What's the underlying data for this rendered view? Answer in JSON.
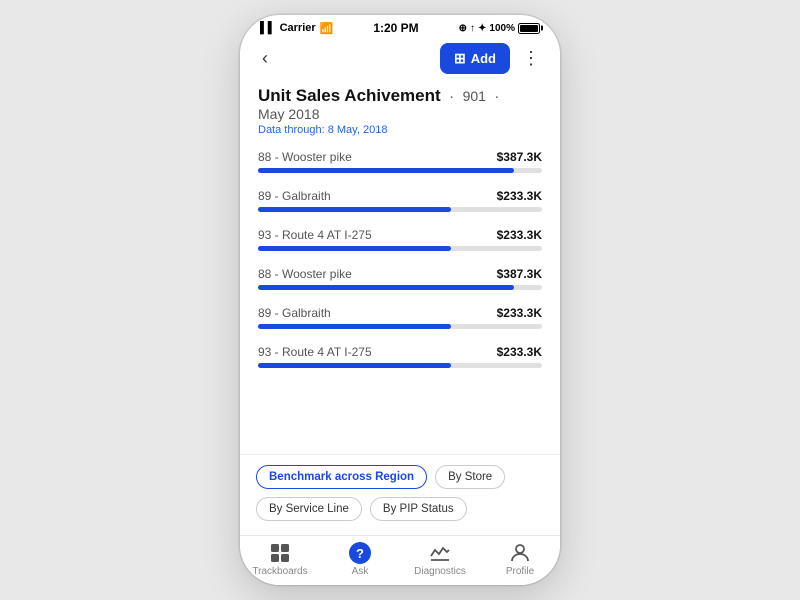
{
  "statusBar": {
    "carrier": "Carrier",
    "time": "1:20 PM",
    "battery": "100%"
  },
  "toolbar": {
    "addLabel": "Add",
    "moreLabel": "⋮"
  },
  "header": {
    "titleMain": "Unit Sales Achivement",
    "dot1": "·",
    "titleNumber": "901",
    "dot2": "·",
    "titleDate": "May 2018",
    "dataThrough": "Data through: 8 May, 2018"
  },
  "bars": [
    {
      "label": "88 - Wooster pike",
      "value": "$387.3K",
      "pct": 90
    },
    {
      "label": "89 - Galbraith",
      "value": "$233.3K",
      "pct": 68
    },
    {
      "label": "93 - Route 4 AT I-275",
      "value": "$233.3K",
      "pct": 68
    },
    {
      "label": "88 - Wooster pike",
      "value": "$387.3K",
      "pct": 90
    },
    {
      "label": "89 - Galbraith",
      "value": "$233.3K",
      "pct": 68
    },
    {
      "label": "93 - Route 4 AT I-275",
      "value": "$233.3K",
      "pct": 68
    }
  ],
  "filters": [
    {
      "label": "Benchmark across Region",
      "active": true
    },
    {
      "label": "By Store",
      "active": false
    },
    {
      "label": "By Service Line",
      "active": false
    },
    {
      "label": "By PIP Status",
      "active": false
    }
  ],
  "nav": [
    {
      "label": "Trackboards",
      "icon": "grid-icon"
    },
    {
      "label": "Ask",
      "icon": "ask-icon"
    },
    {
      "label": "Diagnostics",
      "icon": "diagnostics-icon"
    },
    {
      "label": "Profile",
      "icon": "profile-icon"
    }
  ]
}
